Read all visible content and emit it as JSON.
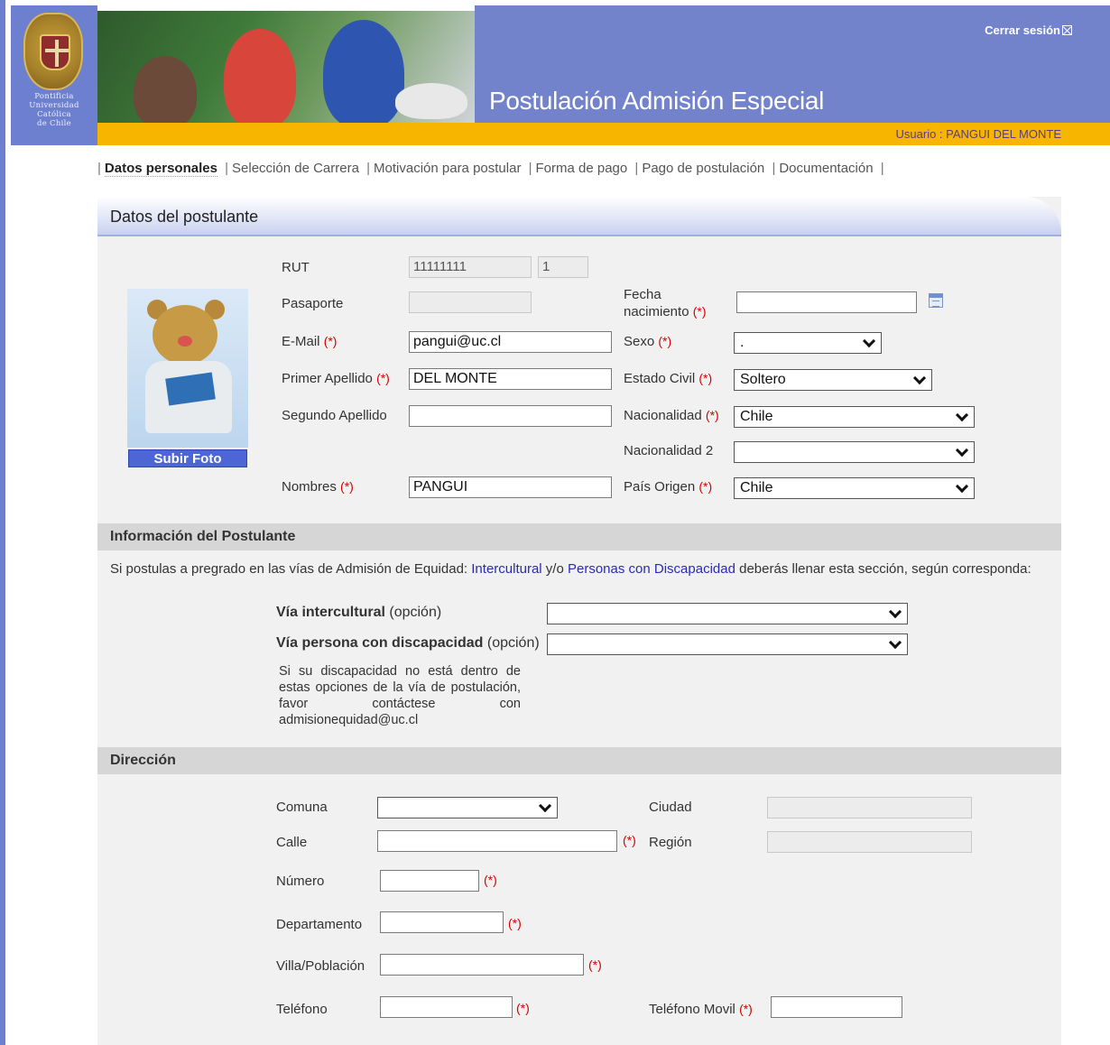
{
  "header": {
    "university_lines": [
      "Pontificia",
      "Universidad",
      "Católica",
      "de Chile"
    ],
    "app_title": "Postulación Admisión Especial",
    "logout_label": "Cerrar sesión",
    "user_label": "Usuario : PANGUI DEL MONTE"
  },
  "nav": {
    "items": [
      "Datos personales",
      "Selección de Carrera",
      "Motivación para postular",
      "Forma de pago",
      "Pago de postulación",
      "Documentación"
    ],
    "separator": "|"
  },
  "card": {
    "title": "Datos del postulante"
  },
  "photo": {
    "upload_label": "Subir Foto"
  },
  "required_mark": "(*)",
  "form": {
    "rut_label": "RUT",
    "rut_value": "11111111",
    "rut_dv": "1",
    "pasaporte_label": "Pasaporte",
    "pasaporte_value": "",
    "email_label": "E-Mail",
    "email_value": "pangui@uc.cl",
    "primer_apellido_label": "Primer Apellido",
    "primer_apellido_value": "DEL MONTE",
    "segundo_apellido_label": "Segundo Apellido",
    "segundo_apellido_value": "",
    "nombres_label": "Nombres",
    "nombres_value": "PANGUI",
    "fecha_label_line1": "Fecha",
    "fecha_label_line2": "nacimiento",
    "fecha_value": "",
    "sexo_label": "Sexo",
    "sexo_value": ".",
    "estado_civil_label": "Estado Civil",
    "estado_civil_value": "Soltero",
    "nacionalidad_label": "Nacionalidad",
    "nacionalidad_value": "Chile",
    "nacionalidad2_label": "Nacionalidad 2",
    "nacionalidad2_value": "",
    "pais_origen_label": "País Origen",
    "pais_origen_value": "Chile"
  },
  "info": {
    "title": "Información del Postulante",
    "text_before": "Si postulas a pregrado en las vías de Admisión de Equidad: ",
    "link1": "Intercultural",
    "text_middle": " y/o ",
    "link2": "Personas con Discapacidad",
    "text_after": " deberás llenar esta sección, según corresponda:",
    "via_intercultural_label": "Vía intercultural",
    "via_discapacidad_label": "Vía persona con discapacidad",
    "option_hint": "(opción)",
    "note": "Si su discapacidad no está dentro de estas opciones de la vía de postulación, favor contáctese con admisionequidad@uc.cl"
  },
  "direccion": {
    "title": "Dirección",
    "comuna_label": "Comuna",
    "calle_label": "Calle",
    "numero_label": "Número",
    "departamento_label": "Departamento",
    "villa_label": "Villa/Población",
    "telefono_label": "Teléfono",
    "ciudad_label": "Ciudad",
    "region_label": "Región",
    "telefono_movil_label": "Teléfono Movil"
  }
}
